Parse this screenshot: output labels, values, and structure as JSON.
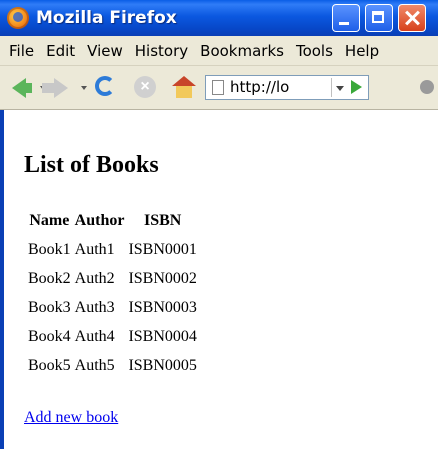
{
  "window": {
    "title": "Mozilla Firefox"
  },
  "menu": [
    "File",
    "Edit",
    "View",
    "History",
    "Bookmarks",
    "Tools",
    "Help"
  ],
  "toolbar": {
    "url": "http://lo"
  },
  "page": {
    "heading": "List of Books",
    "columns": [
      "Name",
      "Author",
      "ISBN"
    ],
    "rows": [
      [
        "Book1",
        "Auth1",
        "ISBN0001"
      ],
      [
        "Book2",
        "Auth2",
        "ISBN0002"
      ],
      [
        "Book3",
        "Auth3",
        "ISBN0003"
      ],
      [
        "Book4",
        "Auth4",
        "ISBN0004"
      ],
      [
        "Book5",
        "Auth5",
        "ISBN0005"
      ]
    ],
    "add_link": "Add new book"
  },
  "icons": {
    "app": "firefox-logo-icon",
    "back": "back-arrow-icon",
    "forward": "forward-arrow-icon",
    "reload": "reload-icon",
    "stop": "stop-icon",
    "home": "home-icon",
    "page": "page-icon",
    "go": "go-arrow-icon"
  },
  "colors": {
    "titlebar": "#0a58e0",
    "chrome": "#ece9d8",
    "link": "#0000ee",
    "close_button": "#d7401b"
  }
}
